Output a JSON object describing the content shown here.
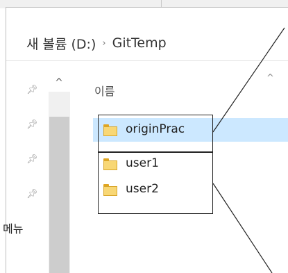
{
  "breadcrumb": {
    "drive": "새 볼륨 (D:)",
    "separator": "›",
    "folder": "GitTemp"
  },
  "sidebar": {
    "label": "메뉴"
  },
  "column_header": {
    "name_label": "이름"
  },
  "files": [
    {
      "name": "originPrac",
      "selected": true
    },
    {
      "name": "user1",
      "selected": false
    },
    {
      "name": "user2",
      "selected": false
    }
  ],
  "colors": {
    "selection": "#cce8ff",
    "folder": "#f8d775",
    "annotation": "#222222"
  },
  "icons": {
    "pin": "pin-icon",
    "folder": "folder-icon",
    "scroll_up": "chevron-up-icon",
    "sort": "sort-up-icon"
  }
}
